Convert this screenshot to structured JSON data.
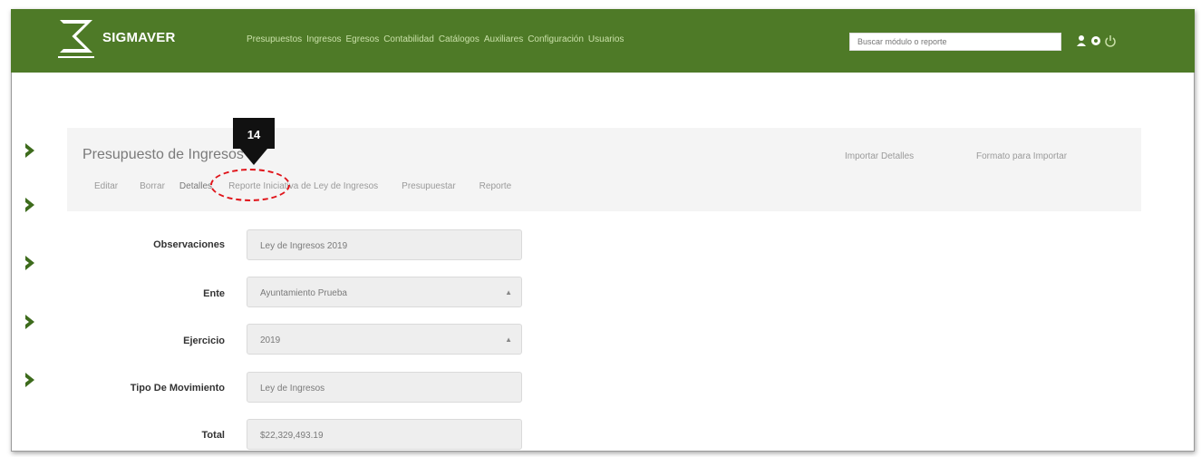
{
  "navbar": {
    "brand": "SIGMAVER",
    "links": [
      "Presupuestos",
      "Ingresos",
      "Egresos",
      "Contabilidad",
      "Catálogos",
      "Auxiliares",
      "Configuración",
      "Usuarios"
    ],
    "search_placeholder": "Buscar módulo o reporte",
    "icons": [
      "user-icon",
      "settings-icon",
      "logout-icon"
    ],
    "color": "#4e7a27"
  },
  "panel": {
    "title": "Presupuesto de Ingresos",
    "actions": [
      "Editar",
      "Borrar",
      "Detalles",
      "Reporte Iniciativa de Ley de Ingresos",
      "Presupuestar",
      "Reporte"
    ],
    "right_actions": [
      "Importar Detalles",
      "Formato para Importar"
    ]
  },
  "callout": {
    "number": "14",
    "target": "Detalles",
    "highlight_color": "#e0141a"
  },
  "form": {
    "observaciones": {
      "label": "Observaciones",
      "value": "Ley de Ingresos 2019"
    },
    "ente": {
      "label": "Ente",
      "value": "Ayuntamiento Prueba"
    },
    "ejercicio": {
      "label": "Ejercicio",
      "value": "2019"
    },
    "tipo_movimiento": {
      "label": "Tipo De Movimiento",
      "value": "Ley de Ingresos"
    },
    "total": {
      "label": "Total",
      "value": "$22,329,493.19"
    }
  },
  "sidebar": {
    "chevrons": [
      "chevron-right-icon",
      "chevron-right-icon",
      "chevron-right-icon",
      "chevron-right-icon",
      "chevron-right-icon"
    ],
    "color": "#3d6b1c"
  }
}
